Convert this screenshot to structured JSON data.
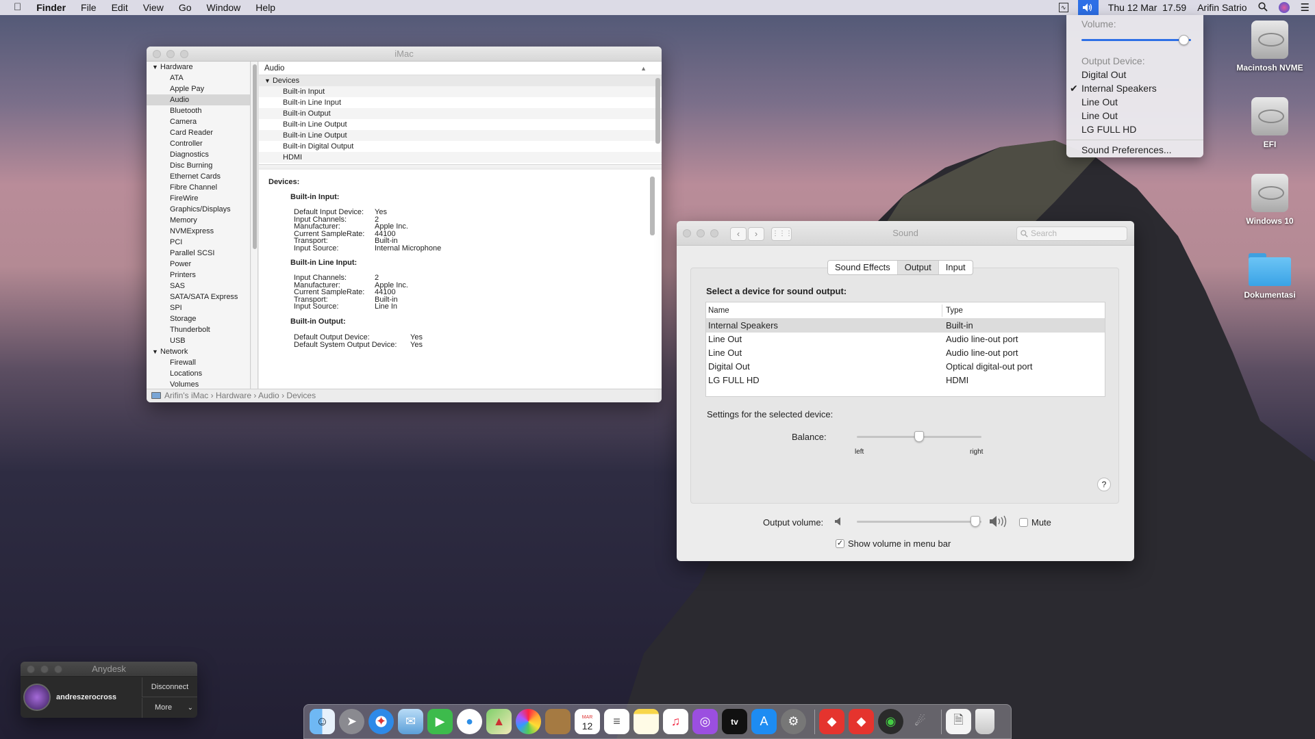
{
  "menubar": {
    "apple": "",
    "app": "Finder",
    "menus": [
      "File",
      "Edit",
      "View",
      "Go",
      "Window",
      "Help"
    ],
    "datetime": "Thu 12 Mar  17.59",
    "user": "Arifin Satrio"
  },
  "volume_menu": {
    "volume_label": "Volume:",
    "volume_level": 0.93,
    "output_label": "Output Device:",
    "devices": [
      "Digital Out",
      "Internal Speakers",
      "Line Out",
      "Line Out",
      "LG FULL HD"
    ],
    "selected_device": "Internal Speakers",
    "prefs": "Sound Preferences..."
  },
  "sysinfo": {
    "title": "iMac",
    "sidebar_hardware": "Hardware",
    "sidebar_items": [
      "ATA",
      "Apple Pay",
      "Audio",
      "Bluetooth",
      "Camera",
      "Card Reader",
      "Controller",
      "Diagnostics",
      "Disc Burning",
      "Ethernet Cards",
      "Fibre Channel",
      "FireWire",
      "Graphics/Displays",
      "Memory",
      "NVMExpress",
      "PCI",
      "Parallel SCSI",
      "Power",
      "Printers",
      "SAS",
      "SATA/SATA Express",
      "SPI",
      "Storage",
      "Thunderbolt",
      "USB"
    ],
    "sidebar_selected": "Audio",
    "sidebar_network": "Network",
    "network_items": [
      "Firewall",
      "Locations",
      "Volumes"
    ],
    "list_header": "Audio",
    "list_group": "Devices",
    "list_items": [
      "Built-in Input",
      "Built-in Line Input",
      "Built-in Output",
      "Built-in Line Output",
      "Built-in Line Output",
      "Built-in Digital Output",
      "HDMI"
    ],
    "detail_title": "Devices:",
    "input_title": "Built-in Input:",
    "input": [
      [
        "Default Input Device:",
        "Yes"
      ],
      [
        "Input Channels:",
        "2"
      ],
      [
        "Manufacturer:",
        "Apple Inc."
      ],
      [
        "Current SampleRate:",
        "44100"
      ],
      [
        "Transport:",
        "Built-in"
      ],
      [
        "Input Source:",
        "Internal Microphone"
      ]
    ],
    "line_input_title": "Built-in Line Input:",
    "line_input": [
      [
        "Input Channels:",
        "2"
      ],
      [
        "Manufacturer:",
        "Apple Inc."
      ],
      [
        "Current SampleRate:",
        "44100"
      ],
      [
        "Transport:",
        "Built-in"
      ],
      [
        "Input Source:",
        "Line In"
      ]
    ],
    "output_title": "Built-in Output:",
    "output": [
      [
        "Default Output Device:",
        "Yes"
      ],
      [
        "Default System Output Device:",
        "Yes"
      ]
    ],
    "path": [
      "Arifin's iMac",
      "Hardware",
      "Audio",
      "Devices"
    ]
  },
  "sound": {
    "title": "Sound",
    "search_placeholder": "Search",
    "tabs": [
      "Sound Effects",
      "Output",
      "Input"
    ],
    "active_tab": "Output",
    "select_label": "Select a device for sound output:",
    "col_name": "Name",
    "col_type": "Type",
    "devices": [
      {
        "name": "Internal Speakers",
        "type": "Built-in"
      },
      {
        "name": "Line Out",
        "type": "Audio line-out port"
      },
      {
        "name": "Line Out",
        "type": "Audio line-out port"
      },
      {
        "name": "Digital Out",
        "type": "Optical digital-out port"
      },
      {
        "name": "LG FULL HD",
        "type": "HDMI"
      }
    ],
    "settings_label": "Settings for the selected device:",
    "balance_label": "Balance:",
    "balance_value": 0.5,
    "left": "left",
    "right": "right",
    "help": "?",
    "output_volume_label": "Output volume:",
    "output_volume": 0.95,
    "mute": "Mute",
    "show_volume": "Show volume in menu bar",
    "show_volume_checked": true
  },
  "desktop": {
    "icons": [
      "Macintosh NVME",
      "EFI",
      "Windows 10",
      "Dokumentasi"
    ]
  },
  "anydesk": {
    "title": "Anydesk",
    "user": "andreszerocross",
    "disconnect": "Disconnect",
    "more": "More"
  },
  "dock": {
    "calendar_month": "MAR",
    "calendar_day": "12",
    "tv_label": "tv"
  }
}
